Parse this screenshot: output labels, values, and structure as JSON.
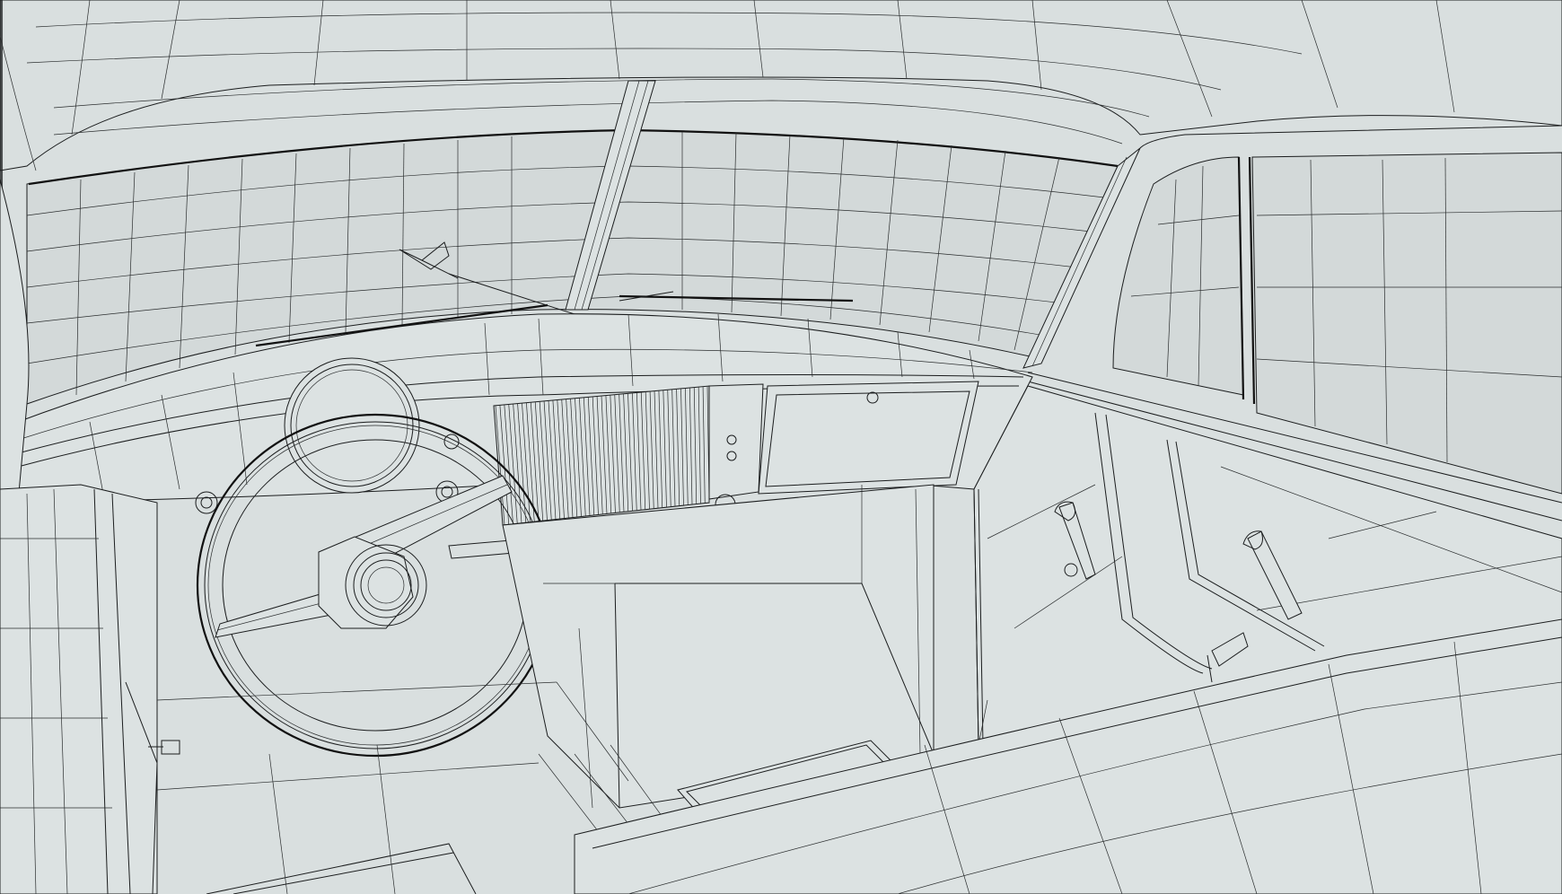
{
  "viewport": {
    "mode": "wireframe",
    "colors": {
      "background": "#d9dfdf",
      "glass": "#d3d9d9",
      "wire": "#1b1d1e",
      "border": "#4a4d4e"
    }
  },
  "objects": [
    {
      "name": "windshield"
    },
    {
      "name": "windshield-pillar"
    },
    {
      "name": "rear-view-mirror"
    },
    {
      "name": "wiper-blade"
    },
    {
      "name": "dashboard"
    },
    {
      "name": "instrument-gauge"
    },
    {
      "name": "steering-wheel"
    },
    {
      "name": "dash-grille"
    },
    {
      "name": "glovebox"
    },
    {
      "name": "side-window"
    },
    {
      "name": "door-panel"
    },
    {
      "name": "door-handle"
    },
    {
      "name": "window-crank"
    },
    {
      "name": "floor"
    },
    {
      "name": "seat"
    },
    {
      "name": "pedal"
    }
  ]
}
